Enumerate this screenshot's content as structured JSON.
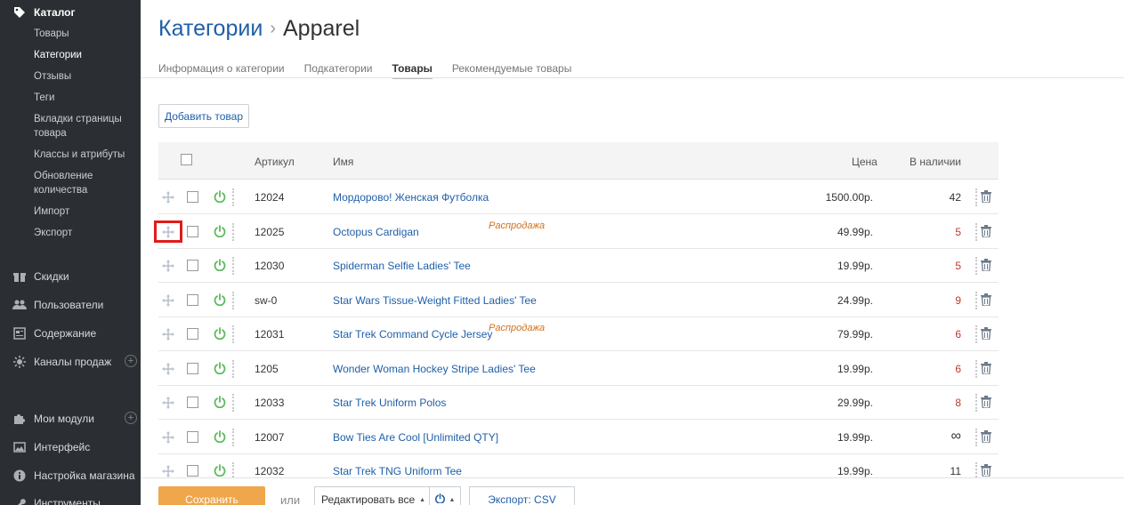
{
  "sidebar": {
    "catalog_title": "Каталог",
    "catalog_items": [
      "Товары",
      "Категории",
      "Отзывы",
      "Теги",
      "Вкладки страницы товара",
      "Классы и атрибуты",
      "Обновление количества",
      "Импорт",
      "Экспорт"
    ],
    "sections": [
      "Скидки",
      "Пользователи",
      "Содержание",
      "Каналы продаж",
      "Мои модули",
      "Интерфейс",
      "Настройка магазина",
      "Инструменты"
    ],
    "active_item": "Категории"
  },
  "header": {
    "breadcrumb_root": "Категории",
    "separator": "›",
    "current": "Apparel"
  },
  "tabs": [
    "Информация о категории",
    "Подкатегории",
    "Товары",
    "Рекомендуемые товары"
  ],
  "active_tab": "Товары",
  "add_button": "Добавить товар",
  "table": {
    "headers": {
      "sku": "Артикул",
      "name": "Имя",
      "price": "Цена",
      "stock": "В наличии"
    },
    "rows": [
      {
        "sku": "12024",
        "name": "Мордорово! Женская Футболка",
        "price": "1500.00р.",
        "stock": "42",
        "badge": ""
      },
      {
        "sku": "12025",
        "name": "Octopus Cardigan",
        "price": "49.99р.",
        "stock": "5",
        "badge": "Распродажа"
      },
      {
        "sku": "12030",
        "name": "Spiderman Selfie Ladies' Tee",
        "price": "19.99р.",
        "stock": "5",
        "badge": ""
      },
      {
        "sku": "sw-0",
        "name": "Star Wars Tissue-Weight Fitted Ladies' Tee",
        "price": "24.99р.",
        "stock": "9",
        "badge": ""
      },
      {
        "sku": "12031",
        "name": "Star Trek Command Cycle Jersey",
        "price": "79.99р.",
        "stock": "6",
        "badge": "Распродажа"
      },
      {
        "sku": "1205",
        "name": "Wonder Woman Hockey Stripe Ladies' Tee",
        "price": "19.99р.",
        "stock": "6",
        "badge": ""
      },
      {
        "sku": "12033",
        "name": "Star Trek Uniform Polos",
        "price": "29.99р.",
        "stock": "8",
        "badge": ""
      },
      {
        "sku": "12007",
        "name": "Bow Ties Are Cool [Unlimited QTY]",
        "price": "19.99р.",
        "stock": "∞",
        "badge": ""
      },
      {
        "sku": "12032",
        "name": "Star Trek TNG Uniform Tee",
        "price": "19.99р.",
        "stock": "11",
        "badge": ""
      }
    ]
  },
  "bottom": {
    "save": "Сохранить",
    "or": "или",
    "edit_all": "Редактировать все",
    "export": "Экспорт: CSV"
  },
  "colors": {
    "sidebar_bg": "#2b2f33",
    "link": "#1f5fa8",
    "save": "#f0a64a",
    "low_stock": "#c0392b",
    "badge": "#d0701e",
    "power": "#5cb85c"
  }
}
